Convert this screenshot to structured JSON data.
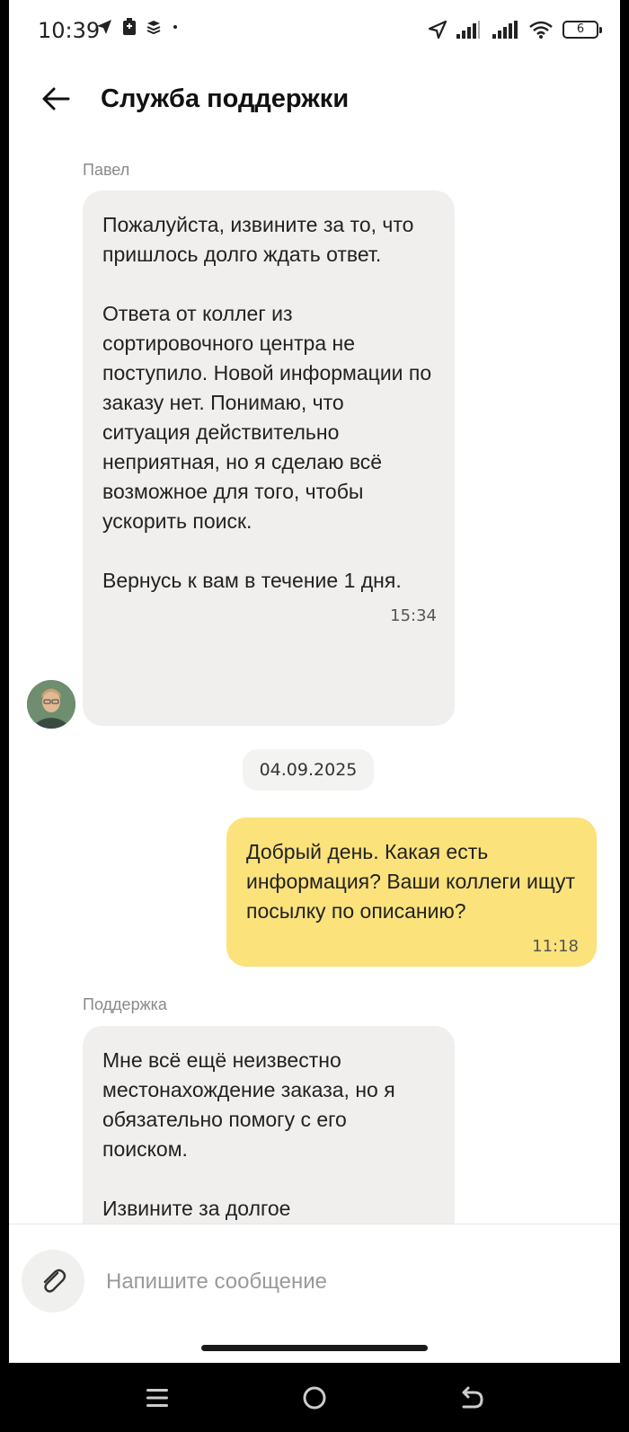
{
  "status_bar": {
    "time": "10:39",
    "battery_level": "6",
    "icons": [
      "telegram-icon",
      "notification-icon",
      "stack-icon",
      "dot-icon",
      "location-icon",
      "signal-icon",
      "signal-icon",
      "wifi-icon",
      "battery-icon"
    ]
  },
  "header": {
    "title": "Служба поддержки",
    "back_icon": "arrow-left-icon"
  },
  "messages": [
    {
      "direction": "incoming",
      "sender": "Павел",
      "paragraphs": [
        "Пожалуйста, извините за то, что пришлось долго ждать ответ.",
        "Ответа от коллег из сортировочного центра не поступило. Новой информации по заказу нет. Понимаю, что ситуация действительно неприятная, но я сделаю всё возможное для того, чтобы ускорить поиск.",
        "Вернусь к вам в течение 1 дня."
      ],
      "time": "15:34"
    },
    {
      "direction": "outgoing",
      "paragraphs": [
        "Добрый день. Какая есть информация? Ваши коллеги ищут посылку по описанию?"
      ],
      "time": "11:18"
    },
    {
      "direction": "incoming",
      "sender": "Поддержка",
      "paragraphs": [
        "Мне всё ещё неизвестно местонахождение заказа, но я обязательно помогу с его поиском.",
        "Извините за долгое"
      ]
    }
  ],
  "date_separator": "04.09.2025",
  "composer": {
    "placeholder": "Напишите сообщение",
    "value": "",
    "attach_icon": "paperclip-icon"
  },
  "colors": {
    "incoming_bubble": "#f0efed",
    "outgoing_bubble": "#fbe27b",
    "background": "#ffffff"
  },
  "nav_bar": {
    "buttons": [
      "menu-icon",
      "home-circle-icon",
      "back-icon"
    ]
  }
}
